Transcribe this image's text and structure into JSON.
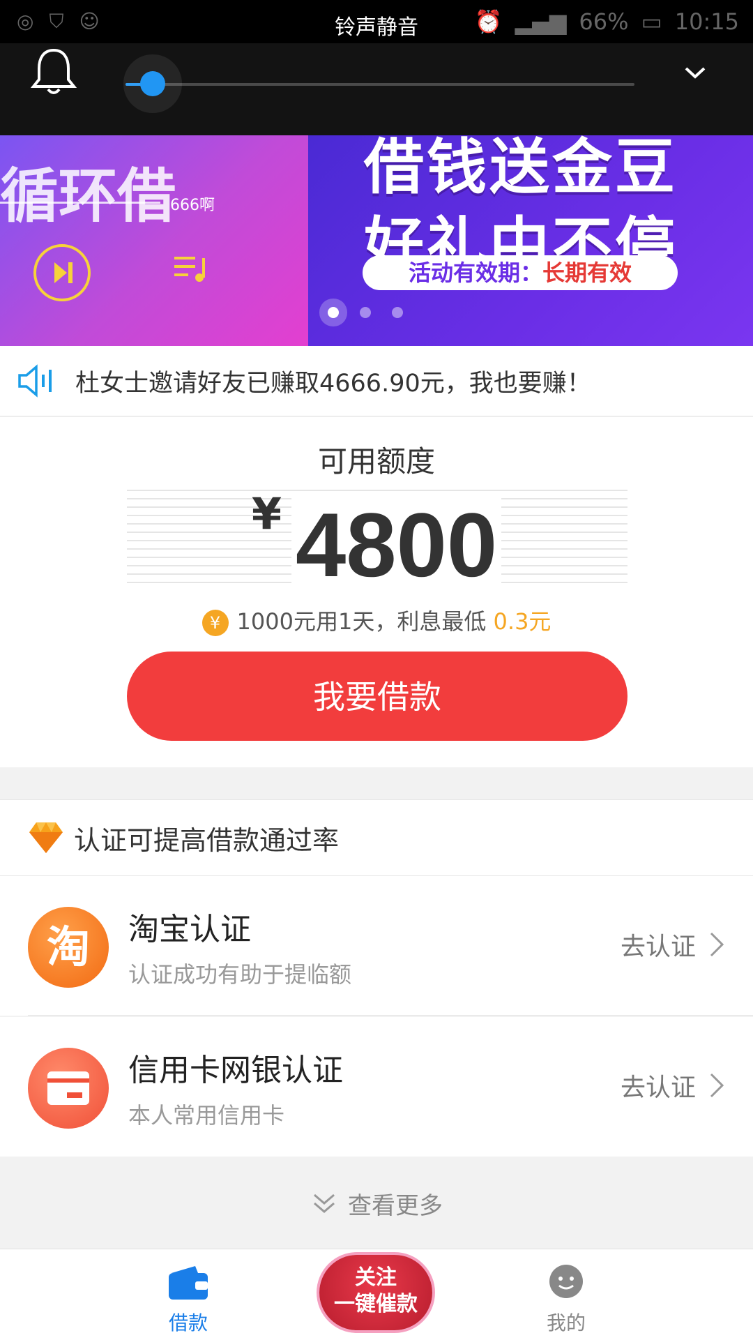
{
  "status_bar": {
    "center_text": "铃声静音",
    "battery": "66%",
    "time": "10:15"
  },
  "volume_panel": {
    "level": 0.05
  },
  "banner": {
    "left_text": "循环借",
    "left_sub": "666啊",
    "headline_1": "借钱送金豆",
    "headline_2": "好礼中不停",
    "pill_prefix": "活动有效期：",
    "pill_highlight": "长期有效",
    "active_dot": 0,
    "dot_count": 3
  },
  "notice": {
    "text": "杜女士邀请好友已赚取4666.90元，我也要赚！"
  },
  "quota": {
    "title": "可用额度",
    "currency": "¥",
    "amount": "4800",
    "tip_coin": "¥",
    "tip_text": "1000元用1天，利息最低 ",
    "tip_highlight": "0.3元",
    "button_label": "我要借款"
  },
  "certification": {
    "header": "认证可提高借款通过率",
    "items": [
      {
        "title": "淘宝认证",
        "subtitle": "认证成功有助于提临额",
        "icon_text": "淘",
        "action": "去认证",
        "color": "#f77a22"
      },
      {
        "title": "信用卡网银认证",
        "subtitle": "本人常用信用卡",
        "icon_text": "",
        "action": "去认证",
        "color": "#f45f43"
      }
    ],
    "more_label": "查看更多"
  },
  "tabbar": {
    "tabs": [
      {
        "label": "借款",
        "active": true
      },
      {
        "label": "我的",
        "active": false
      }
    ],
    "center_button": {
      "line1": "关注",
      "line2": "一键催款"
    },
    "active_color": "#1a7ee8"
  }
}
